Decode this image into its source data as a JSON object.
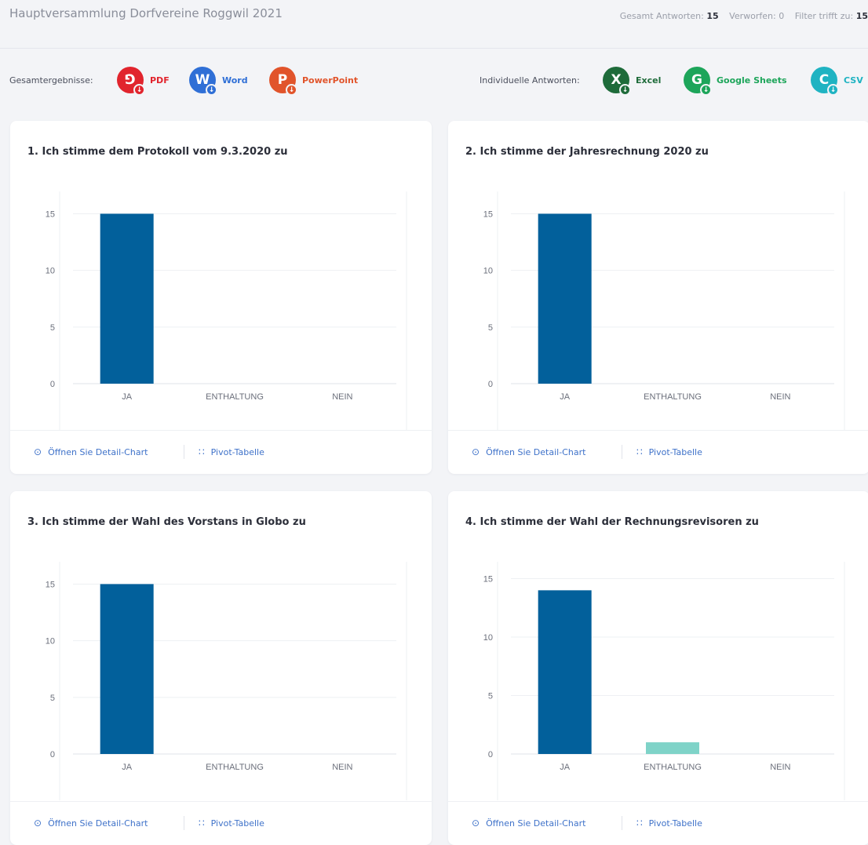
{
  "header": {
    "title": "Hauptversammlung Dorfvereine Roggwil 2021",
    "stats": {
      "total_label": "Gesamt Antworten:",
      "total_value": "15",
      "discarded_label": "Verworfen:",
      "discarded_value": "0",
      "filter_label": "Filter trifft zu:",
      "filter_value": "15"
    }
  },
  "exports": {
    "overall_label": "Gesamtergebnisse:",
    "individual_label": "Individuelle Antworten:",
    "overall": [
      {
        "label": "PDF",
        "letter": "⅁",
        "icon": "pdf-icon",
        "color": "#e1242d",
        "text_color": "#e1242d"
      },
      {
        "label": "Word",
        "letter": "W",
        "icon": "word-icon",
        "color": "#2f6fd6",
        "text_color": "#2f6fd6"
      },
      {
        "label": "PowerPoint",
        "letter": "P",
        "icon": "powerpoint-icon",
        "color": "#e1542b",
        "text_color": "#e1542b"
      }
    ],
    "individual": [
      {
        "label": "Excel",
        "letter": "X",
        "icon": "excel-icon",
        "color": "#1e6b3a",
        "text_color": "#1e6b3a"
      },
      {
        "label": "Google Sheets",
        "letter": "G",
        "icon": "google-sheets-icon",
        "color": "#1da55a",
        "text_color": "#1da55a"
      },
      {
        "label": "CSV",
        "letter": "C",
        "icon": "csv-icon",
        "color": "#1fb3c2",
        "text_color": "#1fb3c2"
      }
    ]
  },
  "footer_buttons": {
    "detail_label": "Öffnen Sie Detail-Chart",
    "pivot_label": "Pivot-Tabelle"
  },
  "colors": {
    "bar_primary": "#02609b",
    "bar_secondary": "#7fd3c8",
    "accent_link": "#3f72c9"
  },
  "cards": [
    {
      "title": "1. Ich stimme dem Protokoll vom 9.3.2020 zu"
    },
    {
      "title": "2. Ich stimme der Jahresrechnung 2020 zu"
    },
    {
      "title": "3. Ich stimme der Wahl des Vorstans in Globo zu"
    },
    {
      "title": "4. Ich stimme der Wahl der Rechnungsrevisoren zu"
    }
  ],
  "chart_data": [
    {
      "type": "bar",
      "title": "1. Ich stimme dem Protokoll vom 9.3.2020 zu",
      "categories": [
        "JA",
        "ENTHALTUNG",
        "NEIN"
      ],
      "values": [
        15,
        0,
        0
      ],
      "ylim": [
        0,
        16
      ],
      "yticks": [
        0,
        5,
        10,
        15
      ],
      "grid": true
    },
    {
      "type": "bar",
      "title": "2. Ich stimme der Jahresrechnung 2020 zu",
      "categories": [
        "JA",
        "ENTHALTUNG",
        "NEIN"
      ],
      "values": [
        15,
        0,
        0
      ],
      "ylim": [
        0,
        16
      ],
      "yticks": [
        0,
        5,
        10,
        15
      ],
      "grid": true
    },
    {
      "type": "bar",
      "title": "3. Ich stimme der Wahl des Vorstans in Globo zu",
      "categories": [
        "JA",
        "ENTHALTUNG",
        "NEIN"
      ],
      "values": [
        15,
        0,
        0
      ],
      "ylim": [
        0,
        16
      ],
      "yticks": [
        0,
        5,
        10,
        15
      ],
      "grid": true
    },
    {
      "type": "bar",
      "title": "4. Ich stimme der Wahl der Rechnungsrevisoren zu",
      "categories": [
        "JA",
        "ENTHALTUNG",
        "NEIN"
      ],
      "values": [
        14,
        1,
        0
      ],
      "ylim": [
        0,
        15.5
      ],
      "yticks": [
        0,
        5,
        10,
        15
      ],
      "grid": true
    }
  ]
}
